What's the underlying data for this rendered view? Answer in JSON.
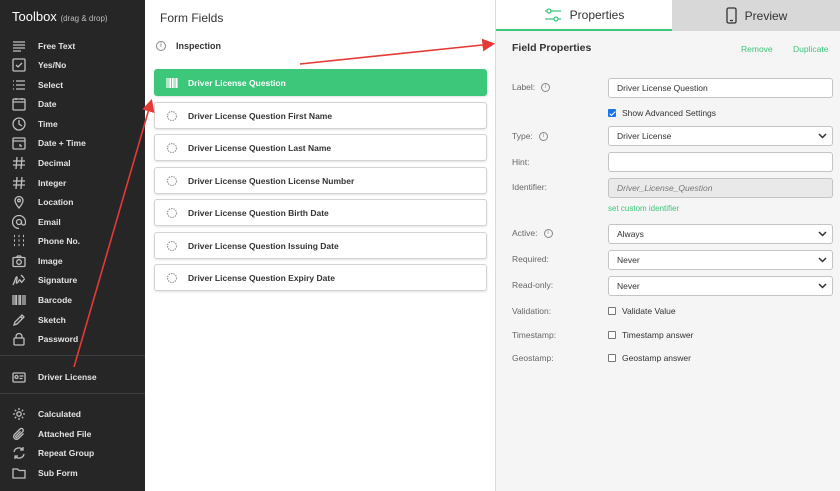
{
  "toolbox": {
    "title": "Toolbox",
    "subtitle": "(drag & drop)",
    "items": [
      {
        "label": "Free Text",
        "icon": "text-lines-icon"
      },
      {
        "label": "Yes/No",
        "icon": "checkbox-icon"
      },
      {
        "label": "Select",
        "icon": "list-icon"
      },
      {
        "label": "Date",
        "icon": "calendar-icon"
      },
      {
        "label": "Time",
        "icon": "clock-icon"
      },
      {
        "label": "Date + Time",
        "icon": "calendar-clock-icon"
      },
      {
        "label": "Decimal",
        "icon": "hash-icon"
      },
      {
        "label": "Integer",
        "icon": "hash-icon"
      },
      {
        "label": "Location",
        "icon": "location-pin-icon"
      },
      {
        "label": "Email",
        "icon": "at-icon"
      },
      {
        "label": "Phone No.",
        "icon": "keypad-icon"
      },
      {
        "label": "Image",
        "icon": "camera-icon"
      },
      {
        "label": "Signature",
        "icon": "signature-icon"
      },
      {
        "label": "Barcode",
        "icon": "barcode-icon"
      },
      {
        "label": "Sketch",
        "icon": "pencil-icon"
      },
      {
        "label": "Password",
        "icon": "lock-icon"
      }
    ],
    "driver_license": {
      "label": "Driver License",
      "icon": "id-card-icon"
    },
    "advanced": [
      {
        "label": "Calculated",
        "icon": "gear-icon"
      },
      {
        "label": "Attached File",
        "icon": "paperclip-icon"
      },
      {
        "label": "Repeat Group",
        "icon": "repeat-icon"
      },
      {
        "label": "Sub Form",
        "icon": "folder-icon"
      }
    ]
  },
  "form_fields": {
    "title": "Form Fields",
    "root": "Inspection",
    "fields": [
      "Driver License Question",
      "Driver License Question First Name",
      "Driver License Question Last Name",
      "Driver License Question License Number",
      "Driver License Question Birth Date",
      "Driver License Question Issuing Date",
      "Driver License Question Expiry Date"
    ]
  },
  "properties": {
    "tab_properties": "Properties",
    "tab_preview": "Preview",
    "title": "Field Properties",
    "remove": "Remove",
    "duplicate": "Duplicate",
    "label_label": "Label:",
    "label_value": "Driver License Question",
    "show_advanced": "Show Advanced Settings",
    "type_label": "Type:",
    "type_value": "Driver License",
    "hint_label": "Hint:",
    "hint_value": "",
    "identifier_label": "Identifier:",
    "identifier_value": "Driver_License_Question",
    "custom_identifier": "set custom identifier",
    "active_label": "Active:",
    "active_value": "Always",
    "required_label": "Required:",
    "required_value": "Never",
    "readonly_label": "Read-only:",
    "readonly_value": "Never",
    "validation_label": "Validation:",
    "validation_option": "Validate Value",
    "timestamp_label": "Timestamp:",
    "timestamp_option": "Timestamp answer",
    "geostamp_label": "Geostamp:",
    "geostamp_option": "Geostamp answer"
  },
  "colors": {
    "accent": "#3cc77b",
    "toolbox_bg": "#262626",
    "arrow": "#e53935"
  }
}
